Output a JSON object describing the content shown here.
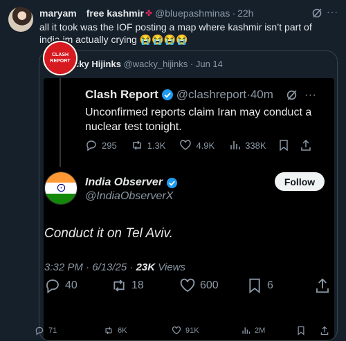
{
  "outer": {
    "name": "maryam",
    "name_suffix": "free kashmir",
    "handle": "@bluepashminas",
    "separator": "·",
    "time": "22h",
    "body": "all it took was the IOF posting a map where kashmir isn’t part of india im actually crying",
    "body_emoji": "😭😭😭😭",
    "stats": {
      "replies": "71",
      "reposts": "6K",
      "likes": "91K",
      "views": "2M"
    }
  },
  "quote": {
    "name": "Wacky Hijinks",
    "handle": "@wacky_hijinks",
    "separator": "·",
    "time": "Jun 14"
  },
  "clash": {
    "logo_line1": "CLASH",
    "logo_line2": "REPORT",
    "name": "Clash Report",
    "handle": "@clashreport",
    "separator": "·",
    "time": "40m",
    "text": "Unconfirmed reports claim Iran may conduct a nuclear test tonight.",
    "stats": {
      "replies": "295",
      "reposts": "1.3K",
      "likes": "4.9K",
      "views": "338K"
    }
  },
  "observer": {
    "name": "India Observer",
    "handle": "@IndiaObserverX",
    "follow_label": "Follow",
    "text": "Conduct it on Tel Aviv.",
    "meta": "3:32 PM · 6/13/25 · ",
    "views_count": "23K",
    "views_label": " Views",
    "stats": {
      "replies": "40",
      "reposts": "18",
      "likes": "600",
      "bookmarks": "6"
    }
  },
  "colors": {
    "background": "#15202b",
    "verified": "#1d9bf0",
    "clash_red": "#d71920",
    "saffron": "#ff9933",
    "india_green": "#138808"
  }
}
